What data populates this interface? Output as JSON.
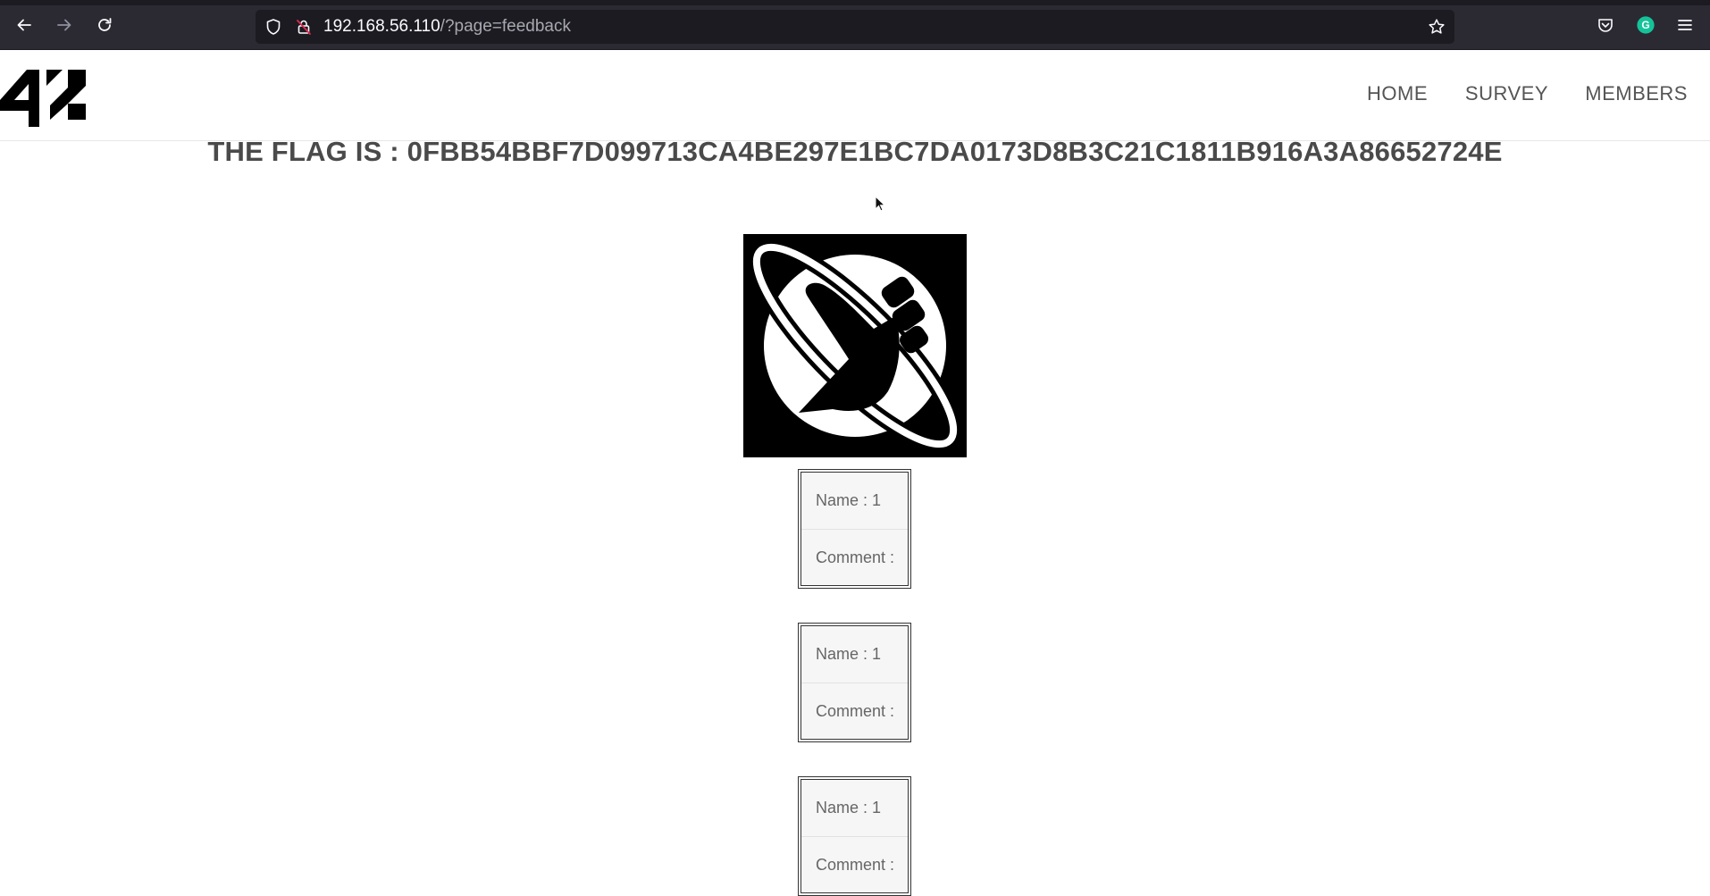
{
  "browser": {
    "url_host": "192.168.56.110",
    "url_path": "/?page=feedback",
    "icons": [
      "back-arrow-icon",
      "forward-arrow-icon",
      "reload-icon",
      "shield-icon",
      "insecure-lock-icon",
      "star-bookmark-icon",
      "pocket-icon",
      "grammarly-icon",
      "hamburger-menu-icon"
    ],
    "grammarly_letter": "G"
  },
  "header": {
    "logo_text": "42",
    "nav": [
      "HOME",
      "SURVEY",
      "MEMBERS"
    ]
  },
  "flag": {
    "text": "THE FLAG IS : 0FBB54BBF7D099713CA4BE297E1BC7DA0173D8B3C21C1811B916A3A86652724E"
  },
  "comments": [
    {
      "name_label": "Name : 1",
      "comment_label": "Comment :"
    },
    {
      "name_label": "Name : 1",
      "comment_label": "Comment :"
    },
    {
      "name_label": "Name : 1",
      "comment_label": "Comment :"
    }
  ],
  "colors": {
    "chrome_bg": "#2b2a33",
    "urlbar_bg": "#1c1b22",
    "flag_text": "#4a4a4a",
    "nav_text": "#555555",
    "grammarly": "#15c39a"
  }
}
